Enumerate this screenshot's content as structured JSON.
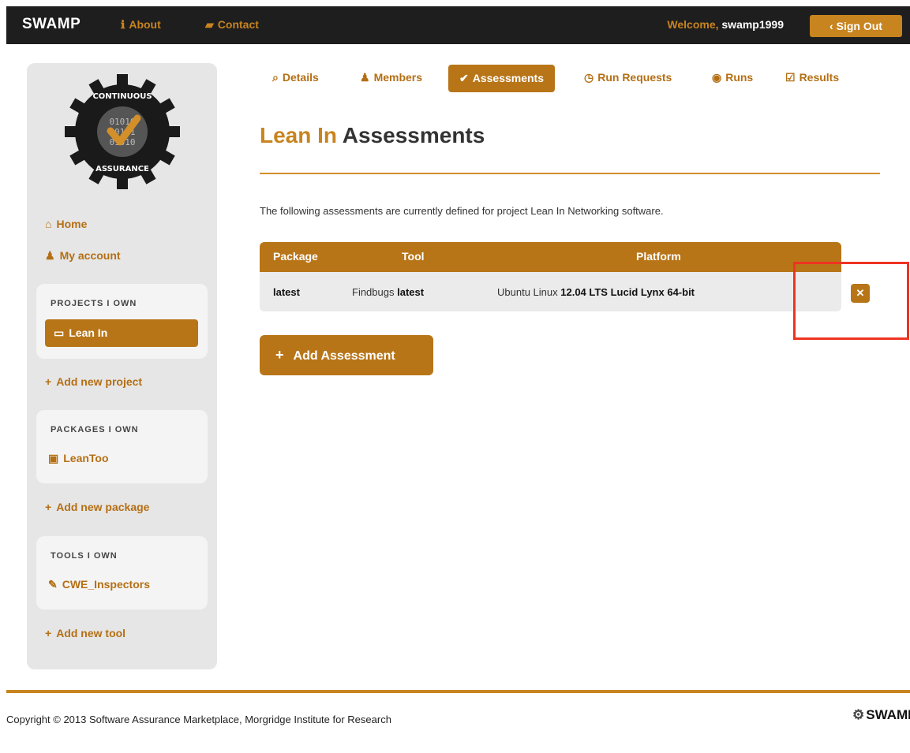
{
  "header": {
    "brand": "SWAMP",
    "nav": [
      {
        "icon": "info-icon",
        "glyph": "ℹ",
        "label": "About"
      },
      {
        "icon": "chat-icon",
        "glyph": "▰",
        "label": "Contact"
      }
    ],
    "welcome_prefix": "Welcome,",
    "username": "swamp1999",
    "signout_icon": "‹",
    "signout_label": "Sign Out"
  },
  "sidebar": {
    "logo_text_top": "CONTINUOUS",
    "logo_text_bottom": "ASSURANCE",
    "home": "Home",
    "my_account": "My account",
    "projects_title": "PROJECTS I OWN",
    "projects": [
      "Lean In"
    ],
    "add_project": "Add new project",
    "packages_title": "PACKAGES I OWN",
    "packages": [
      "LeanToo"
    ],
    "add_package": "Add new package",
    "tools_title": "TOOLS I OWN",
    "tools": [
      "CWE_Inspectors"
    ],
    "add_tool": "Add new tool"
  },
  "tabs": [
    {
      "icon": "search-icon",
      "label": "Details"
    },
    {
      "icon": "user-icon",
      "label": "Members"
    },
    {
      "icon": "check-circle-icon",
      "label": "Assessments",
      "active": true
    },
    {
      "icon": "clock-icon",
      "label": "Run Requests"
    },
    {
      "icon": "play-circle-icon",
      "label": "Runs"
    },
    {
      "icon": "checkbox-icon",
      "label": "Results"
    }
  ],
  "page": {
    "project": "Lean In",
    "title_rest": "Assessments",
    "description": "The following assessments are currently defined for project Lean In Networking software."
  },
  "table": {
    "headers": [
      "Package",
      "Tool",
      "Platform"
    ],
    "rows": [
      {
        "package_version": "latest",
        "tool_name": "Findbugs",
        "tool_version": "latest",
        "platform_name": "Ubuntu Linux",
        "platform_version": "12.04 LTS Lucid Lynx 64-bit"
      }
    ],
    "delete_glyph": "✕"
  },
  "add_assessment": "Add Assessment",
  "footer": {
    "copyright": "Copyright © 2013 Software Assurance Marketplace, Morgridge Institute for Research",
    "logo": "SWAMP"
  },
  "colors": {
    "accent": "#c8841e",
    "accent_dark": "#b87518",
    "topbar": "#1e1e1e",
    "highlight": "#ee3322"
  }
}
